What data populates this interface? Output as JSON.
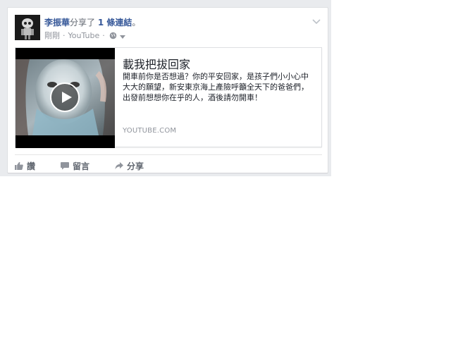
{
  "post": {
    "author": "李振華",
    "action": "分享了",
    "count_link": "1 條連結",
    "period": "。",
    "timestamp": "剛剛",
    "source": "YouTube",
    "separator": "·"
  },
  "preview": {
    "title": "載我把拔回家",
    "description": "開車前你是否想過？你的平安回家，是孩子們小小心中 大大的願望，新安東京海上產險呼籲全天下的爸爸們， 出發前想想你在乎的人，酒後請勿開車！",
    "domain": "YOUTUBE.COM"
  },
  "actions": {
    "like": "讚",
    "comment": "留言",
    "share": "分享"
  },
  "icons": {
    "globe": "globe-icon",
    "caret": "caret-down-icon",
    "menu": "chevron-down-icon",
    "play": "play-icon",
    "like": "thumbs-up-icon",
    "comment": "comment-icon",
    "share": "share-arrow-icon"
  },
  "colors": {
    "link_blue": "#365899",
    "meta_grey": "#90949c",
    "action_grey": "#616770",
    "background": "#e9ebee"
  }
}
